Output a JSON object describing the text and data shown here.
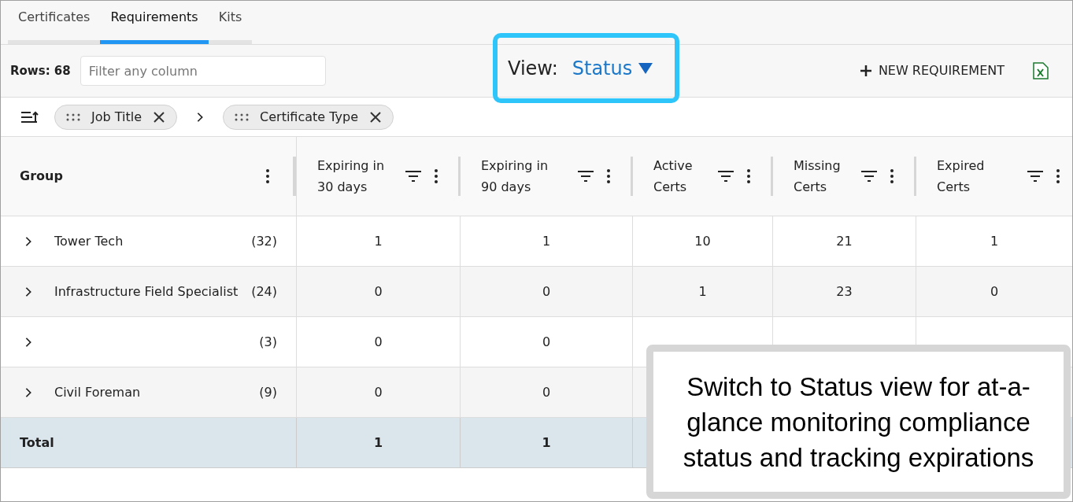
{
  "tabs": [
    {
      "label": "Certificates",
      "selected": false
    },
    {
      "label": "Requirements",
      "selected": true
    },
    {
      "label": "Kits",
      "selected": false
    }
  ],
  "toolbar": {
    "rows_label": "Rows: 68",
    "filter": {
      "placeholder": "Filter any column"
    },
    "view_label": "View:",
    "view_value": "Status",
    "new_button": "NEW REQUIREMENT"
  },
  "grouping": {
    "chips": [
      {
        "label": "Job Title"
      },
      {
        "label": "Certificate Type"
      }
    ]
  },
  "table": {
    "group_column": "Group",
    "columns": [
      {
        "line1": "Expiring in",
        "line2": "30 days"
      },
      {
        "line1": "Expiring in",
        "line2": "90 days"
      },
      {
        "line1": "Active",
        "line2": "Certs"
      },
      {
        "line1": "Missing",
        "line2": "Certs"
      },
      {
        "line1": "Expired",
        "line2": "Certs"
      }
    ],
    "rows": [
      {
        "name": "Tower Tech",
        "count": "(32)",
        "cells": [
          "1",
          "1",
          "10",
          "21",
          "1"
        ]
      },
      {
        "name": "Infrastructure Field Specialist",
        "count": "(24)",
        "cells": [
          "0",
          "0",
          "1",
          "23",
          "0"
        ]
      },
      {
        "count": "(3)",
        "cells": [
          "0",
          "0"
        ]
      },
      {
        "name": "Civil Foreman",
        "count": "(9)",
        "cells": [
          "0",
          "0"
        ]
      }
    ],
    "total": {
      "label": "Total",
      "cells": [
        "1",
        "1"
      ]
    }
  },
  "callout": {
    "text": "Switch to Status view for at-a-glance monitoring compliance status and tracking expirations"
  }
}
